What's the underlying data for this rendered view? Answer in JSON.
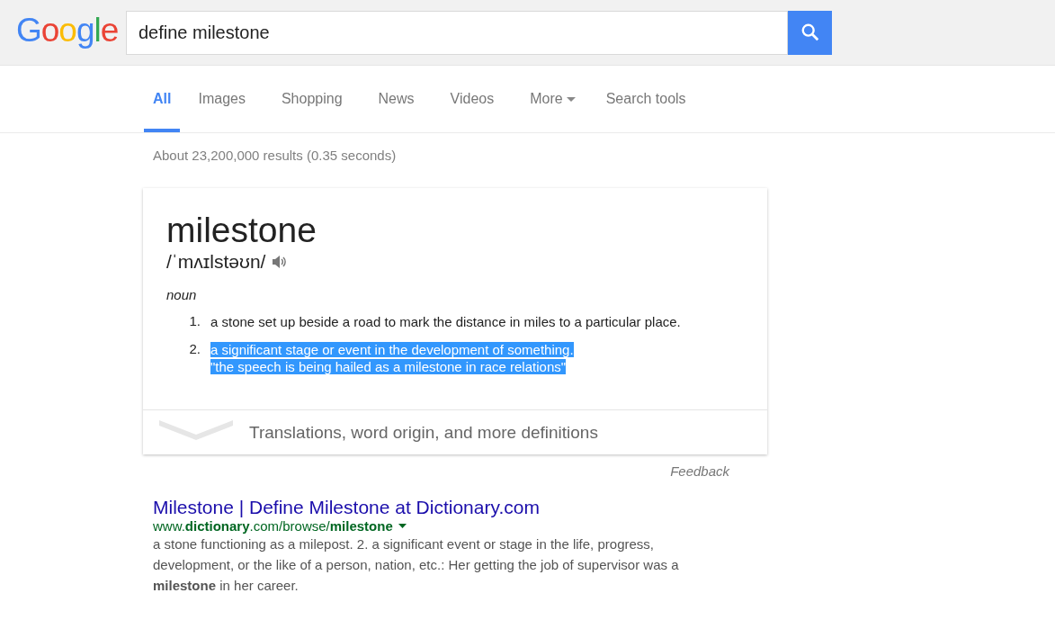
{
  "logo": "Google",
  "search": {
    "value": "define milestone"
  },
  "tabs": [
    {
      "label": "All",
      "selected": true,
      "dropdown": false
    },
    {
      "label": "Images",
      "selected": false,
      "dropdown": false
    },
    {
      "label": "Shopping",
      "selected": false,
      "dropdown": false
    },
    {
      "label": "News",
      "selected": false,
      "dropdown": false
    },
    {
      "label": "Videos",
      "selected": false,
      "dropdown": false
    },
    {
      "label": "More",
      "selected": false,
      "dropdown": true
    },
    {
      "label": "Search tools",
      "selected": false,
      "dropdown": false
    }
  ],
  "result_stats": "About 23,200,000 results (0.35 seconds)",
  "definition_card": {
    "word": "milestone",
    "pronunciation": "/ˈmʌɪlstəʊn/",
    "part_of_speech": "noun",
    "senses": [
      {
        "number": "1.",
        "text": "a stone set up beside a road to mark the distance in miles to a particular place.",
        "highlighted": false
      },
      {
        "number": "2.",
        "text": "a significant stage or event in the development of something.",
        "example": "\"the speech is being hailed as a milestone in race relations\"",
        "highlighted": true
      }
    ],
    "more_link": "Translations, word origin, and more definitions"
  },
  "feedback": "Feedback",
  "results": [
    {
      "title": "Milestone | Define Milestone at Dictionary.com",
      "url": "www.**dictionary**.com/browse/**milestone**",
      "snippet": "a stone functioning as a milepost. 2. a significant event or stage in the life, progress, development, or the like of a person, nation, etc.: Her getting the job of supervisor was a **milestone** in her career."
    }
  ]
}
